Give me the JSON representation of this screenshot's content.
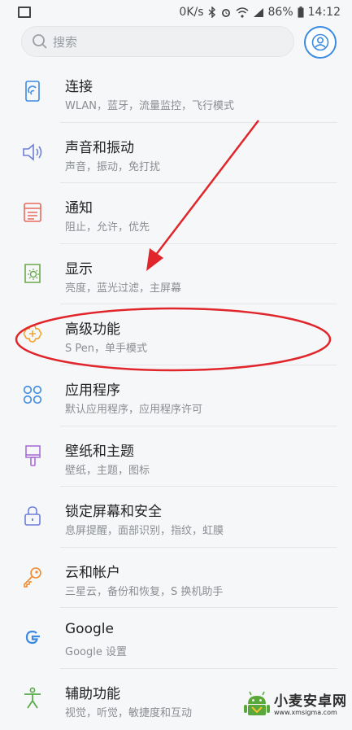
{
  "status_bar": {
    "speed": "0K/s",
    "battery": "86%",
    "time": "14:12"
  },
  "search": {
    "placeholder": "搜索"
  },
  "items": [
    {
      "title": "连接",
      "subtitle": "WLAN，蓝牙，流量监控，飞行模式",
      "icon": "connections-icon",
      "color": "#3c8be0"
    },
    {
      "title": "声音和振动",
      "subtitle": "声音，振动，免打扰",
      "icon": "sound-icon",
      "color": "#6f7fd8"
    },
    {
      "title": "通知",
      "subtitle": "阻止，允许，优先",
      "icon": "notifications-icon",
      "color": "#e76a5d"
    },
    {
      "title": "显示",
      "subtitle": "亮度，蓝光过滤，主屏幕",
      "icon": "display-icon",
      "color": "#6aa84f"
    },
    {
      "title": "高级功能",
      "subtitle": "S Pen，单手模式",
      "icon": "advanced-features-icon",
      "color": "#f0a630"
    },
    {
      "title": "应用程序",
      "subtitle": "默认应用程序，应用程序许可",
      "icon": "apps-icon",
      "color": "#3c8be0"
    },
    {
      "title": "壁纸和主题",
      "subtitle": "壁纸，主题，图标",
      "icon": "wallpaper-icon",
      "color": "#a86ed6"
    },
    {
      "title": "锁定屏幕和安全",
      "subtitle": "息屏提醒，面部识别，指纹，虹膜",
      "icon": "lock-icon",
      "color": "#6f7fd8"
    },
    {
      "title": "云和帐户",
      "subtitle": "三星云，备份和恢复，S 换机助手",
      "icon": "key-icon",
      "color": "#f08a30"
    },
    {
      "title": "Google",
      "subtitle": "Google 设置",
      "icon": "google-icon",
      "color": "#3c8be0"
    },
    {
      "title": "辅助功能",
      "subtitle": "视觉，听觉，敏捷度和互动",
      "icon": "accessibility-icon",
      "color": "#5aaa4a"
    }
  ],
  "watermark": {
    "name": "小麦安卓网",
    "url": "www.xmsigma.com"
  },
  "colors": {
    "annotation": "#e0262b",
    "accent": "#3c8be0"
  }
}
